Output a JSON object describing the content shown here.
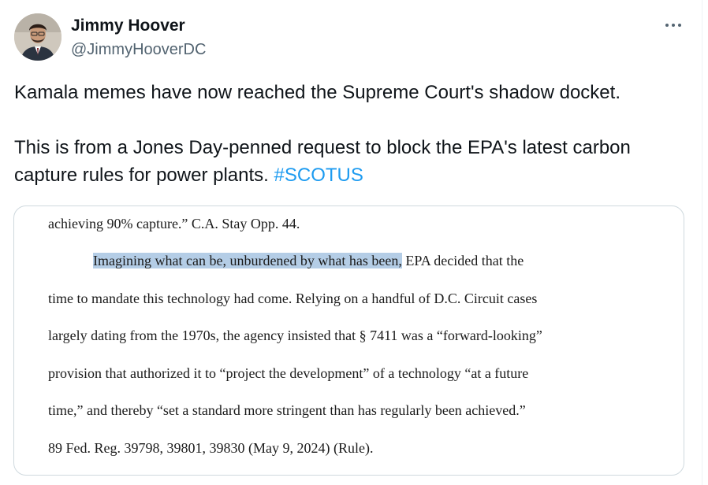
{
  "author": {
    "name": "Jimmy Hoover",
    "handle": "@JimmyHooverDC",
    "avatar_icon": "person-avatar"
  },
  "more_icon": "more-horizontal-icon",
  "tweet": {
    "line1": "Kamala memes have now reached the Supreme Court's shadow docket.",
    "line2": "This is from a Jones Day-penned request to block the EPA's latest carbon",
    "line3": "capture rules for power plants.",
    "hashtag": "#SCOTUS"
  },
  "document": {
    "line1": "achieving 90% capture.” C.A. Stay Opp. 44.",
    "line2_highlight": "Imagining what can be, unburdened by what has been,",
    "line2_rest": " EPA decided that the",
    "line3": "time to mandate this technology had come. Relying on a handful of D.C. Circuit cases",
    "line4": "largely dating from the 1970s, the agency insisted that § 7411 was a “forward-looking”",
    "line5": "provision that authorized it to “project the development” of a technology “at a future",
    "line6": "time,” and thereby “set a standard more stringent than has regularly been achieved.”",
    "line7": "89 Fed. Reg. 39798, 39801, 39830 (May 9, 2024) (Rule)."
  },
  "colors": {
    "text": "#0f1419",
    "secondary": "#536471",
    "link": "#1d9bf0",
    "highlight": "#b4cde6",
    "border": "#cfd9de"
  }
}
